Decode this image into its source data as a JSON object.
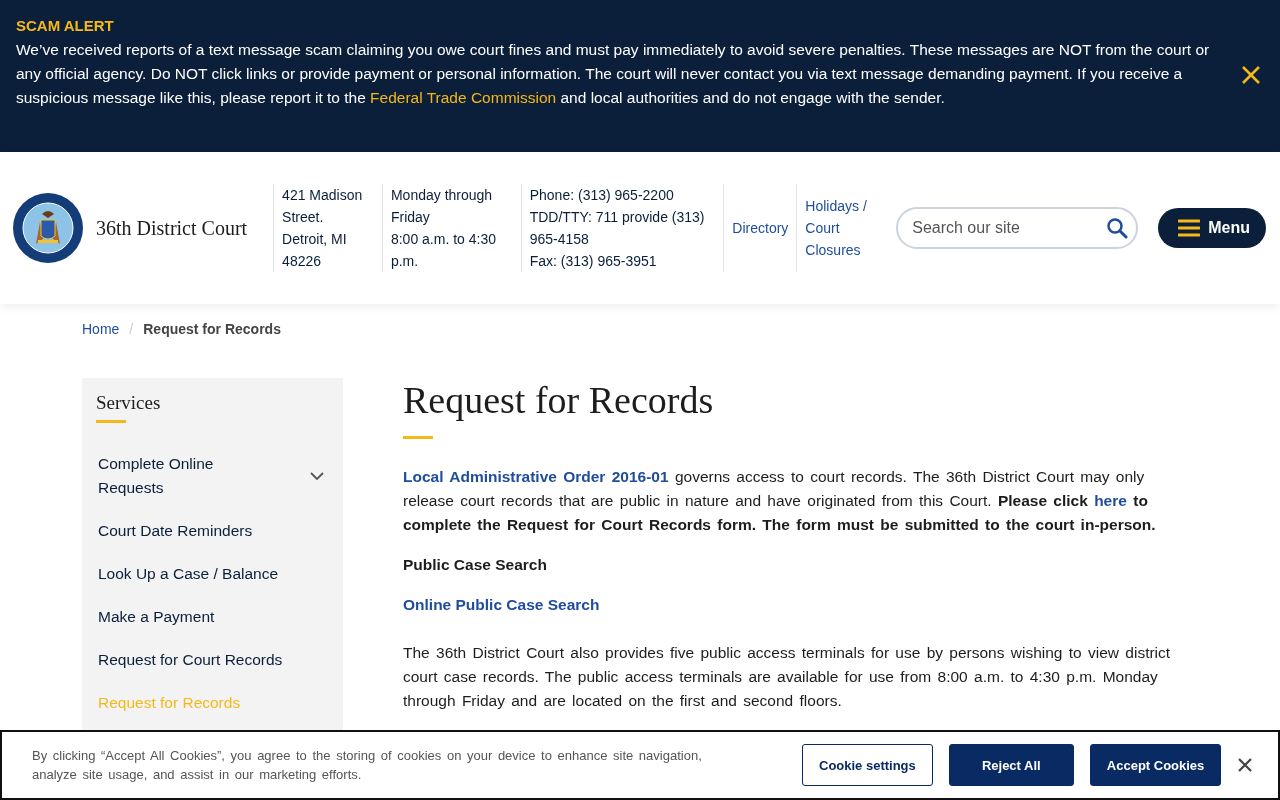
{
  "alert": {
    "title": "SCAM ALERT",
    "text_before": "We’ve received reports of a text message scam claiming you owe court fines and must pay immediately to avoid severe penalties. These messages are NOT from the court or any official agency. Do NOT click links or provide payment or personal information. The court will never contact you via text message demanding payment. If you receive a suspicious message like this, please report it to the",
    "link": "Federal Trade Commission",
    "text_after": "and local authorities and do not engage with the sender."
  },
  "header": {
    "site_name": "36th District Court",
    "info_columns": [
      [
        "421 Madison",
        "Street.",
        "Detroit, MI",
        "48226"
      ],
      [
        "Monday through",
        "Friday",
        "8:00 a.m. to 4:30",
        "p.m."
      ],
      [
        "Phone: (313) 965-2200",
        "TDD/TTY: 711 provide (313)",
        "965-4158",
        "Fax: (313) 965-3951"
      ]
    ],
    "links": [
      "Directory",
      "Holidays / Court Closures"
    ],
    "search": {
      "placeholder": "Search our site"
    },
    "menu_button": "Menu"
  },
  "breadcrumb": {
    "separator": "/",
    "items": [
      {
        "label": "Home",
        "selected": false
      },
      {
        "label": "Request for Records",
        "selected": true
      }
    ]
  },
  "sidebar": {
    "title": "Services",
    "items": [
      {
        "label": "Complete Online Requests",
        "expandable": true,
        "selected": false
      },
      {
        "label": "Court Date Reminders",
        "expandable": false,
        "selected": false
      },
      {
        "label": "Look Up a Case / Balance",
        "expandable": false,
        "selected": false
      },
      {
        "label": "Make a Payment",
        "expandable": false,
        "selected": false
      },
      {
        "label": "Request for Court Records",
        "expandable": false,
        "selected": false
      },
      {
        "label": "Request for Records",
        "expandable": false,
        "selected": true
      }
    ]
  },
  "main": {
    "title": "Request for Records",
    "blocks": [
      {
        "kind": "paragraph",
        "parts": [
          {
            "kind": "link",
            "text": "Local Administrative Order 2016-01"
          },
          {
            "kind": "plain",
            "text": "governs  access  to  court records.  The 36th  District  Court  may only  release  court  records  that are public  in  nature and have originated  from this Court."
          },
          {
            "kind": "bold",
            "text": "Please click"
          },
          {
            "kind": "link",
            "text": "here"
          },
          {
            "kind": "bold",
            "text": "to complete the Request for Court Records form. The form must be submitted to the court in-person."
          }
        ]
      },
      {
        "kind": "heading",
        "text": "Public Case Search"
      },
      {
        "kind": "link",
        "text": "Online Public Case Search"
      },
      {
        "kind": "paragraph",
        "parts": [
          {
            "kind": "plain",
            "text": "The 36th District Court also provides five public access terminals for use by persons wishing to view district court case records. The public access terminals are available for use from 8:00 a.m. to 4:30 p.m. Monday through Friday and are located on the first and second floors."
          }
        ]
      }
    ]
  },
  "cookie_banner": {
    "text": "By clicking “Accept All Cookies”, you agree to the storing of cookies on your device to enhance site navigation, analyze site usage, and assist in our marketing efforts.",
    "buttons": [
      {
        "label": "Cookie settings",
        "kind": "outline"
      },
      {
        "label": "Reject All",
        "kind": "solid"
      },
      {
        "label": "Accept Cookies",
        "kind": "solid"
      }
    ]
  }
}
